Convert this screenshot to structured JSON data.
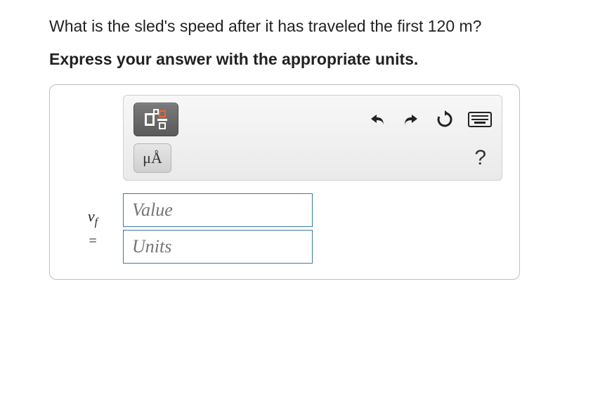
{
  "question": "What is the sled's speed after it has traveled the first 120 m?",
  "instruction": "Express your answer with the appropriate units.",
  "toolbar": {
    "template_button": "template-fraction",
    "units_button_label": "μÅ",
    "undo": "undo",
    "redo": "redo",
    "reset": "reset",
    "keyboard": "keyboard",
    "help": "?"
  },
  "answer": {
    "variable_symbol": "v",
    "variable_subscript": "f",
    "equals": "=",
    "value_placeholder": "Value",
    "units_placeholder": "Units",
    "value": "",
    "units": ""
  }
}
